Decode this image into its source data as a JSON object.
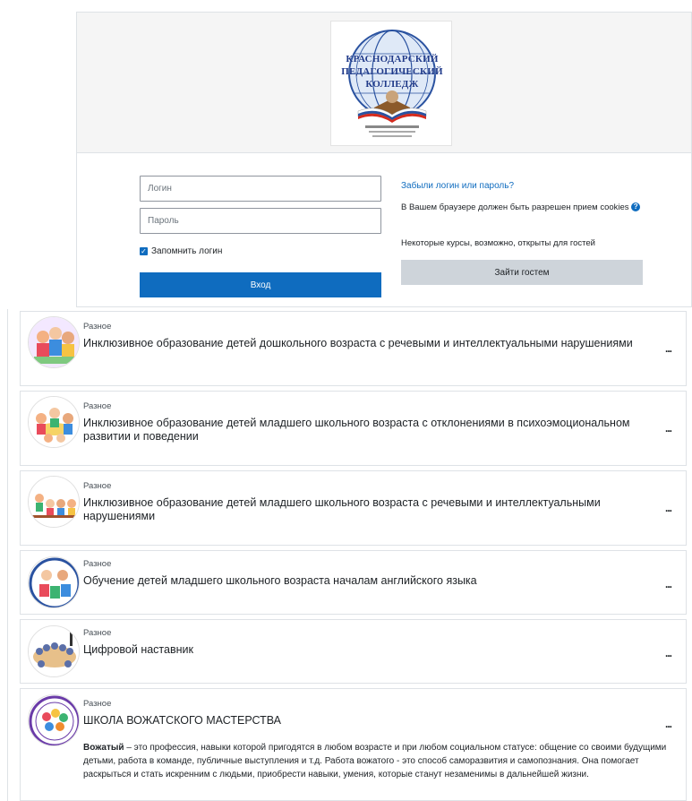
{
  "logo": {
    "line1": "КРАСНОДАРСКИЙ",
    "line2": "ПЕДАГОГИЧЕСКИЙ",
    "line3": "КОЛЛЕДЖ"
  },
  "login": {
    "username_placeholder": "Логин",
    "password_placeholder": "Пароль",
    "remember_label": "Запомнить логин",
    "submit_label": "Вход",
    "forgot_link": "Забыли логин или пароль?",
    "cookies_notice": "В Вашем браузере должен быть разрешен прием cookies",
    "guests_note": "Некоторые курсы, возможно, открыты для гостей",
    "guest_button": "Зайти гостем"
  },
  "courses": [
    {
      "category": "Разное",
      "title": "Инклюзивное образование детей дошкольного возраста с речевыми и интеллектуальными нарушениями",
      "menu": "..."
    },
    {
      "category": "Разное",
      "title": "Инклюзивное образование детей младшего школьного возраста с отклонениями в психоэмоциональном развитии и поведении",
      "menu": "..."
    },
    {
      "category": "Разное",
      "title": "Инклюзивное образование детей младшего школьного возраста с речевыми и интеллектуальными нарушениями",
      "menu": "..."
    },
    {
      "category": "Разное",
      "title": "Обучение детей младшего школьного возраста началам английского языка",
      "menu": "..."
    },
    {
      "category": "Разное",
      "title": "Цифровой наставник",
      "menu": "..."
    },
    {
      "category": "Разное",
      "title": "ШКОЛА ВОЖАТСКОГО МАСТЕРСТВА",
      "menu": "...",
      "summary_bold": "Вожатый",
      "summary_text": " – это профессия, навыки которой пригодятся в любом возрасте и при любом социальном статусе: общение со своими будущими детьми, работа в команде, публичные выступления и т.д. Работа вожатого - это способ саморазвития и самопознания. Она помогает раскрыться и стать искренним с людьми, приобрести навыки, умения, которые станут незаменимы в дальнейшей жизни."
    }
  ],
  "colors": {
    "primary": "#0f6cbf",
    "secondary": "#ced4da",
    "border": "#dee2e6"
  }
}
